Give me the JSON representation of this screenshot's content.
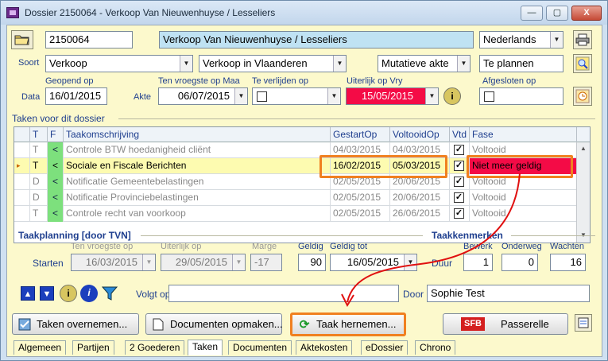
{
  "window": {
    "title": "Dossier 2150064 - Verkoop Van Nieuwenhuyse / Lesseliers",
    "minimize": "—",
    "maximize": "▢",
    "close": "X"
  },
  "header": {
    "dossier_number": "2150064",
    "dossier_name": "Verkoop Van Nieuwenhuyse / Lesseliers",
    "language": "Nederlands",
    "soort_label": "Soort",
    "soort": "Verkoop",
    "region": "Verkoop in Vlaanderen",
    "akte_type": "Mutatieve akte",
    "status": "Te plannen",
    "data_label": "Data",
    "geopend_op_label": "Geopend op",
    "geopend_op": "16/01/2015",
    "akte_label": "Akte",
    "ten_vroegste_label": "Ten vroegste op Maa",
    "ten_vroegste": "06/07/2015",
    "te_verlijden_label": "Te verlijden op",
    "uiterlijk_label": "Uiterlijk op Vry",
    "uiterlijk": "15/05/2015",
    "afgesloten_label": "Afgesloten op"
  },
  "tasks": {
    "group_title": "Taken voor dit dossier",
    "columns": [
      "T",
      "F",
      "Taakomschrijving",
      "GestartOp",
      "VoltooidOp",
      "Vtd",
      "Fase"
    ],
    "rows": [
      {
        "t": "T",
        "f": "<",
        "desc": "Controle BTW hoedanigheid cliënt",
        "start": "04/03/2015",
        "done": "04/03/2015",
        "vtd": "✓",
        "fase": "Voltooid"
      },
      {
        "t": "T",
        "f": "<",
        "desc": "Sociale en Fiscale Berichten",
        "start": "16/02/2015",
        "done": "05/03/2015",
        "vtd": "✓",
        "fase": "Niet meer geldig"
      },
      {
        "t": "D",
        "f": "<",
        "desc": "Notificatie Gemeentebelastingen",
        "start": "02/05/2015",
        "done": "20/06/2015",
        "vtd": "✓",
        "fase": "Voltooid"
      },
      {
        "t": "D",
        "f": "<",
        "desc": "Notificatie Provinciebelastingen",
        "start": "02/05/2015",
        "done": "20/06/2015",
        "vtd": "✓",
        "fase": "Voltooid"
      },
      {
        "t": "T",
        "f": "<",
        "desc": "Controle recht van voorkoop",
        "start": "02/05/2015",
        "done": "26/06/2015",
        "vtd": "✓",
        "fase": "Voltooid"
      }
    ]
  },
  "planning": {
    "group_title": "Taakplanning  [door TVN]",
    "ten_vroegste_label": "Ten vroegste op",
    "uiterlijk_label": "Uiterlijk op",
    "marge_label": "Marge",
    "geldig_label": "Geldig",
    "geldig_tot_label": "Geldig tot",
    "starten_label": "Starten",
    "ten_vroegste": "16/03/2015",
    "uiterlijk": "29/05/2015",
    "marge": "-17",
    "geldig": "90",
    "geldig_tot": "16/05/2015"
  },
  "kenmerken": {
    "group_title": "Taakkenmerken",
    "bewerk_label": "Bewerk",
    "onderweg_label": "Onderweg",
    "wachten_label": "Wachten",
    "duur_label": "Duur",
    "bewerk": "1",
    "onderweg": "0",
    "wachten": "16"
  },
  "followup": {
    "volgt_op_label": "Volgt op",
    "volgt_op": "",
    "door_label": "Door",
    "door": "Sophie Test"
  },
  "buttons": {
    "taken_overnemen": "Taken overnemen...",
    "documenten_opmaken": "Documenten opmaken...",
    "taak_hernemen": "Taak hernemen...",
    "passerelle": "Passerelle",
    "sfb": "SFB"
  },
  "tabs": [
    "Algemeen",
    "Partijen",
    "2 Goederen",
    "Taken",
    "Documenten",
    "Aktekosten",
    "eDossier",
    "Chrono"
  ],
  "active_tab": "Taken",
  "colors": {
    "accent_orange": "#f08020",
    "alert_red": "#f40b46",
    "panel_yellow": "#fcf9cc"
  }
}
